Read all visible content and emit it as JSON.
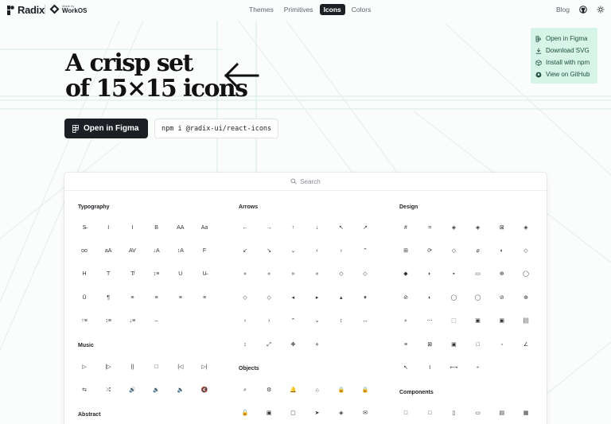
{
  "header": {
    "brand": "Radix",
    "workos_small": "Made by",
    "workos_big": "WorkOS",
    "nav": [
      {
        "label": "Themes",
        "active": false
      },
      {
        "label": "Primitives",
        "active": false
      },
      {
        "label": "Icons",
        "active": true
      },
      {
        "label": "Colors",
        "active": false
      }
    ],
    "blog": "Blog"
  },
  "hero": {
    "title_line1": "A crisp set",
    "title_line2": "of 15×15 icons",
    "cta_label": "Open in Figma",
    "npm_command": "npm i @radix-ui/react-icons"
  },
  "links": [
    {
      "label": "Open in Figma",
      "icon": "figma-icon"
    },
    {
      "label": "Download SVG",
      "icon": "download-icon"
    },
    {
      "label": "Install with npm",
      "icon": "cube-icon"
    },
    {
      "label": "View on GitHub",
      "icon": "github-icon"
    }
  ],
  "search": {
    "placeholder": "Search"
  },
  "sections": {
    "typography": "Typography",
    "music": "Music",
    "abstract": "Abstract",
    "arrows": "Arrows",
    "objects": "Objects",
    "design": "Design",
    "components": "Components"
  },
  "glyphs": {
    "typography": [
      "S̶",
      "I",
      "I",
      "B",
      "AA",
      "Aa",
      "oo",
      "aA",
      "AV",
      "↓A",
      "↕A",
      "F",
      "H",
      "T",
      "T̸",
      "↕≡",
      "U",
      "U̶",
      "Ū",
      "¶",
      "≡",
      "≡",
      "≡",
      "≡",
      "↑≡",
      "↕≡",
      "↓≡",
      "–"
    ],
    "music": [
      "▷",
      "|▷",
      "||",
      "□",
      "|◁",
      "▷|",
      "⇆",
      "⤮",
      "🔊",
      "🔉",
      "🔈",
      "🔇"
    ],
    "arrows": [
      "←",
      "→",
      "↑",
      "↓",
      "↖",
      "↗",
      "↙",
      "↘",
      "⌄",
      "‹",
      "›",
      "⌃",
      "»",
      "«",
      "»",
      "«",
      "◇",
      "◇",
      "◇",
      "◇",
      "◂",
      "▸",
      "▴",
      "▾",
      "‹",
      "›",
      "⌃",
      "⌄",
      "↕",
      "↔",
      "↕",
      "⤢",
      "✥",
      "⋄"
    ],
    "objects": [
      "⌕",
      "⚙",
      "🔔",
      "⌂",
      "🔒",
      "🔒",
      "🔓",
      "▣",
      "▢",
      "➤",
      "◈",
      "✉"
    ],
    "design": [
      "#",
      "⌗",
      "◈",
      "◈",
      "⊠",
      "◈",
      "⊞",
      "⟳",
      "◇",
      "⌀",
      "◐",
      "◇",
      "◆",
      "◐",
      "▪",
      "▭",
      "⊕",
      "◯",
      "⊘",
      "◐",
      "◯",
      "◯",
      "⊘",
      "⊕",
      "⌕",
      "⋯",
      "⬚",
      "▣",
      "▣",
      "||||",
      "≡",
      "⊠",
      "▣",
      "□",
      "▫",
      "∠",
      "↖",
      "I",
      "⟷",
      "÷"
    ],
    "components": [
      "□",
      "□",
      "▯",
      "▭",
      "▤",
      "▦"
    ]
  }
}
